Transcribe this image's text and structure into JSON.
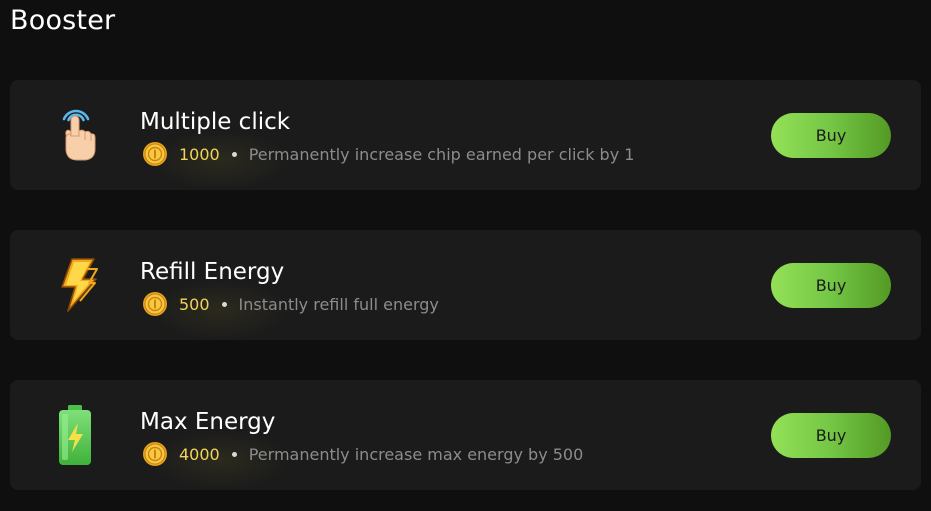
{
  "page": {
    "title": "Booster"
  },
  "boosters": [
    {
      "icon": "tap-finger-icon",
      "name": "Multiple click",
      "price": "1000",
      "description": "Permanently increase chip earned per click by 1",
      "button_label": "Buy"
    },
    {
      "icon": "lightning-bolt-icon",
      "name": "Refill Energy",
      "price": "500",
      "description": "Instantly refill full energy",
      "button_label": "Buy"
    },
    {
      "icon": "battery-charging-icon",
      "name": "Max Energy",
      "price": "4000",
      "description": "Permanently increase max energy by 500",
      "button_label": "Buy"
    }
  ],
  "colors": {
    "background": "#0f0f0f",
    "card": "#1b1b1b",
    "price": "#f3d35a",
    "description": "#8c8c8c",
    "button_gradient_start": "#94e157",
    "button_gradient_end": "#539a25"
  }
}
